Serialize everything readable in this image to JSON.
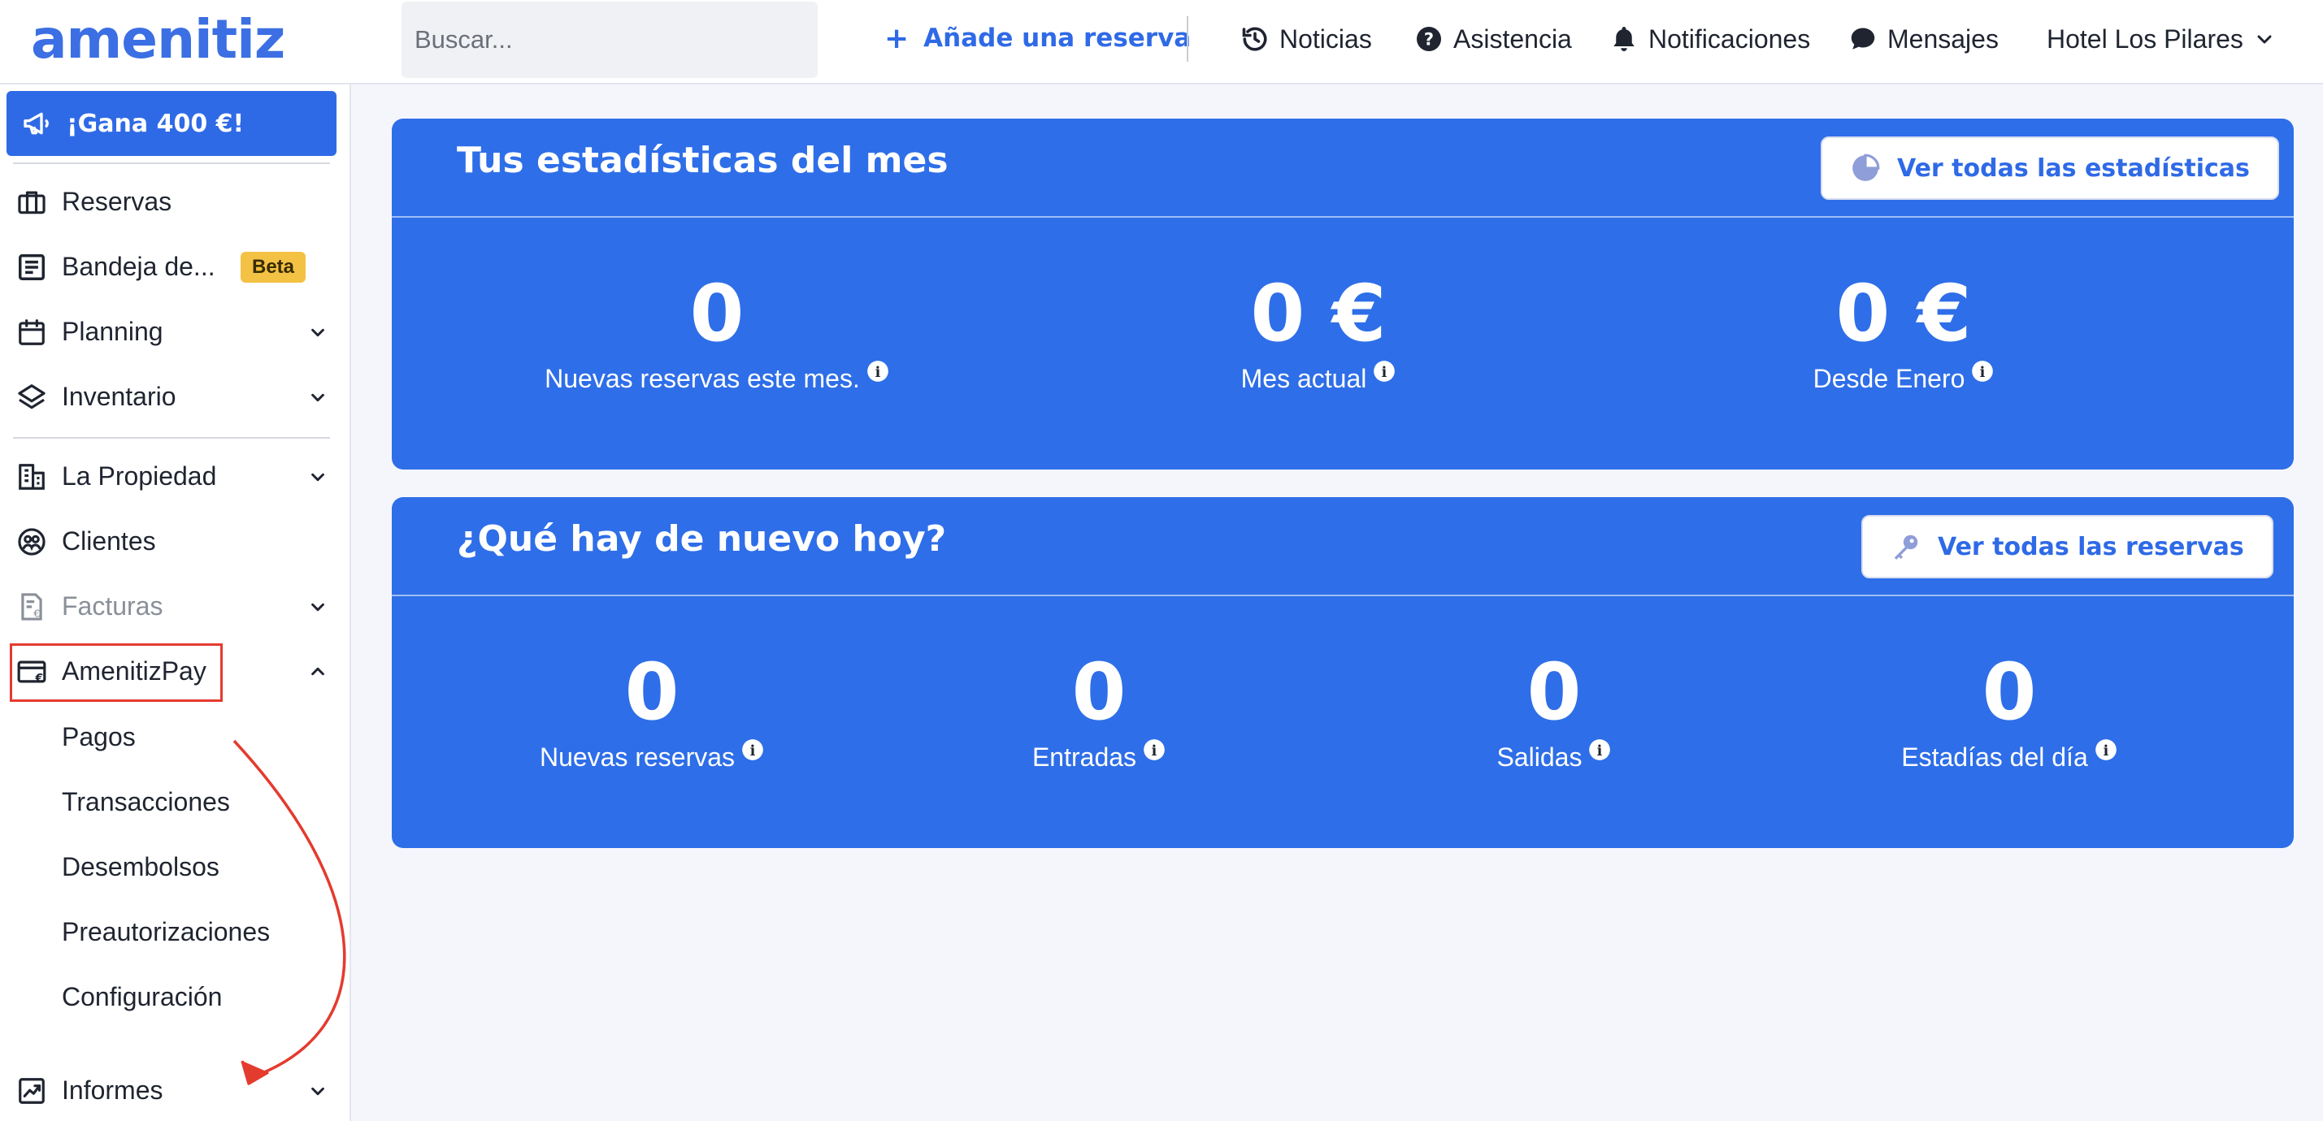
{
  "brand": {
    "logo_text": "amenitiz",
    "accent": "#2f6ae6"
  },
  "header": {
    "search_placeholder": "Buscar...",
    "add_reservation": "Añade una reserva",
    "nav": [
      {
        "label": "Noticias",
        "icon": "history-icon"
      },
      {
        "label": "Asistencia",
        "icon": "help-icon"
      },
      {
        "label": "Notificaciones",
        "icon": "bell-icon"
      },
      {
        "label": "Mensajes",
        "icon": "chat-icon"
      }
    ],
    "hotel_name": "Hotel Los Pilares"
  },
  "sidebar": {
    "promo": "¡Gana 400 €!",
    "items": [
      {
        "label": "Reservas",
        "icon": "briefcase-icon"
      },
      {
        "label": "Bandeja de...",
        "icon": "inbox-icon",
        "badge": "Beta"
      },
      {
        "label": "Planning",
        "icon": "calendar-icon"
      },
      {
        "label": "Inventario",
        "icon": "layers-icon"
      },
      {
        "label": "La Propiedad",
        "icon": "building-icon"
      },
      {
        "label": "Clientes",
        "icon": "users-icon"
      },
      {
        "label": "Facturas",
        "icon": "invoice-icon"
      },
      {
        "label": "AmenitizPay",
        "icon": "card-euro-icon"
      },
      {
        "label": "Informes",
        "icon": "chart-icon"
      }
    ],
    "amenitizpay_sub": [
      "Pagos",
      "Transacciones",
      "Desembolsos",
      "Preautorizaciones",
      "Configuración"
    ]
  },
  "stats_card": {
    "title": "Tus estadísticas del mes",
    "button": "Ver todas las estadísticas",
    "stats": [
      {
        "value": "0",
        "caption": "Nuevas reservas este mes."
      },
      {
        "value": "0 €",
        "caption": "Mes actual"
      },
      {
        "value": "0 €",
        "caption": "Desde Enero"
      }
    ]
  },
  "today_card": {
    "title": "¿Qué hay de nuevo hoy?",
    "button": "Ver todas las reservas",
    "stats": [
      {
        "value": "0",
        "caption": "Nuevas reservas"
      },
      {
        "value": "0",
        "caption": "Entradas"
      },
      {
        "value": "0",
        "caption": "Salidas"
      },
      {
        "value": "0",
        "caption": "Estadías del día"
      }
    ]
  }
}
